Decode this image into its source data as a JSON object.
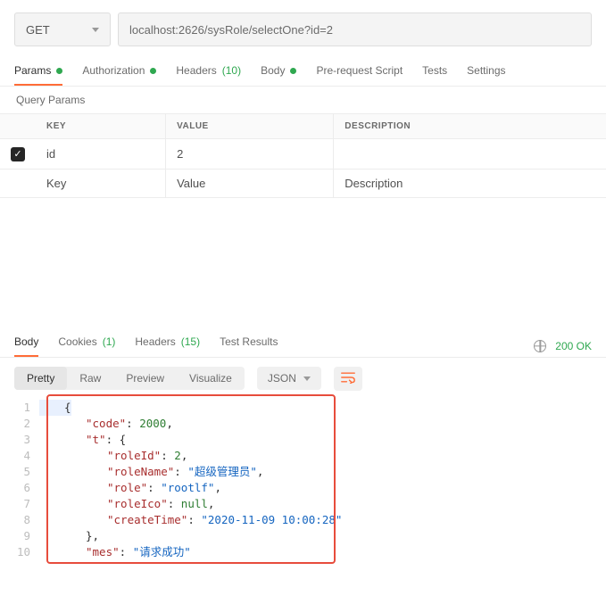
{
  "request": {
    "method": "GET",
    "url": "localhost:2626/sysRole/selectOne?id=2"
  },
  "request_tabs": {
    "params": "Params",
    "authorization": "Authorization",
    "headers_label": "Headers",
    "headers_count": "(10)",
    "body": "Body",
    "prerequest": "Pre-request Script",
    "tests": "Tests",
    "settings": "Settings"
  },
  "query_params": {
    "heading": "Query Params",
    "header_key": "KEY",
    "header_value": "VALUE",
    "header_desc": "DESCRIPTION",
    "rows": [
      {
        "key": "id",
        "value": "2",
        "checked": true
      }
    ],
    "placeholders": {
      "key": "Key",
      "value": "Value",
      "desc": "Description"
    }
  },
  "response_tabs": {
    "body": "Body",
    "cookies_label": "Cookies",
    "cookies_count": "(1)",
    "headers_label": "Headers",
    "headers_count": "(15)",
    "tests": "Test Results"
  },
  "status": {
    "text": "200 OK"
  },
  "res_toolbar": {
    "pretty": "Pretty",
    "raw": "Raw",
    "preview": "Preview",
    "visualize": "Visualize",
    "format": "JSON"
  },
  "code_lines": [
    {
      "n": 1,
      "html": "<span class='punc'>{</span>",
      "indent": 1,
      "cursor": true
    },
    {
      "n": 2,
      "html": "<span class='key'>\"code\"</span><span class='punc'>: </span><span class='num'>2000</span><span class='punc'>,</span>",
      "indent": 2
    },
    {
      "n": 3,
      "html": "<span class='key'>\"t\"</span><span class='punc'>: {</span>",
      "indent": 2
    },
    {
      "n": 4,
      "html": "<span class='key'>\"roleId\"</span><span class='punc'>: </span><span class='num'>2</span><span class='punc'>,</span>",
      "indent": 3
    },
    {
      "n": 5,
      "html": "<span class='key'>\"roleName\"</span><span class='punc'>: </span><span class='str'>\"超级管理员\"</span><span class='punc'>,</span>",
      "indent": 3
    },
    {
      "n": 6,
      "html": "<span class='key'>\"role\"</span><span class='punc'>: </span><span class='str'>\"rootlf\"</span><span class='punc'>,</span>",
      "indent": 3
    },
    {
      "n": 7,
      "html": "<span class='key'>\"roleIco\"</span><span class='punc'>: </span><span class='null'>null</span><span class='punc'>,</span>",
      "indent": 3
    },
    {
      "n": 8,
      "html": "<span class='key'>\"createTime\"</span><span class='punc'>: </span><span class='str'>\"2020-11-09 10:00:28\"</span>",
      "indent": 3
    },
    {
      "n": 9,
      "html": "<span class='punc'>},</span>",
      "indent": 2
    },
    {
      "n": 10,
      "html": "<span class='key'>\"mes\"</span><span class='punc'>: </span><span class='str'>\"请求成功\"</span>",
      "indent": 2
    }
  ]
}
